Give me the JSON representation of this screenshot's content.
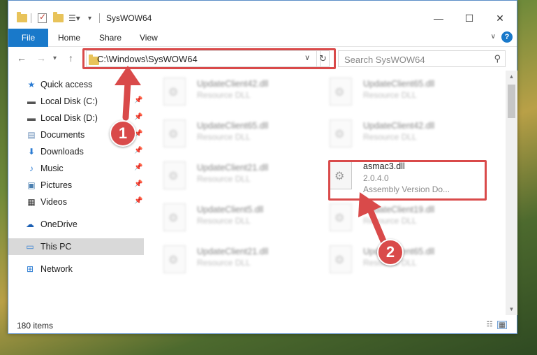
{
  "window": {
    "title": "SysWOW64",
    "controls": {
      "minimize": "—",
      "maximize": "☐",
      "close": "✕"
    }
  },
  "ribbon": {
    "file_tab": "File",
    "tabs": [
      "Home",
      "Share",
      "View"
    ],
    "help": "?"
  },
  "nav": {
    "address": "C:\\Windows\\SysWOW64",
    "search_placeholder": "Search SysWOW64",
    "icons": {
      "back": "back-arrow-icon",
      "forward": "forward-arrow-icon",
      "recent": "chevron-down-icon",
      "up": "up-arrow-icon",
      "refresh": "refresh-icon",
      "search": "search-icon"
    }
  },
  "sidebar": {
    "items": [
      {
        "label": "Quick access",
        "icon": "star-icon",
        "pinned": false
      },
      {
        "label": "Local Disk (C:)",
        "icon": "drive-icon",
        "pinned": true
      },
      {
        "label": "Local Disk (D:)",
        "icon": "drive-icon",
        "pinned": true
      },
      {
        "label": "Documents",
        "icon": "documents-icon",
        "pinned": true
      },
      {
        "label": "Downloads",
        "icon": "downloads-icon",
        "pinned": true
      },
      {
        "label": "Music",
        "icon": "music-icon",
        "pinned": true
      },
      {
        "label": "Pictures",
        "icon": "pictures-icon",
        "pinned": true
      },
      {
        "label": "Videos",
        "icon": "videos-icon",
        "pinned": true
      },
      {
        "label": "OneDrive",
        "icon": "cloud-icon",
        "pinned": false
      },
      {
        "label": "This PC",
        "icon": "computer-icon",
        "pinned": false,
        "selected": true
      },
      {
        "label": "Network",
        "icon": "network-icon",
        "pinned": false
      }
    ]
  },
  "files": [
    {
      "name": "UpdateClient42.dll",
      "type": "Resource DLL"
    },
    {
      "name": "UpdateClient65.dll",
      "type": "Resource DLL"
    },
    {
      "name": "UpdateClient65.dll",
      "type": "Resource DLL"
    },
    {
      "name": "UpdateClient42.dll",
      "type": "Resource DLL"
    },
    {
      "name": "UpdateClient21.dll",
      "type": "Resource DLL"
    },
    {
      "name": "asmac3.dll",
      "version": "2.0.4.0",
      "type": "Assembly Version Do..."
    },
    {
      "name": "UpdateClient5.dll",
      "type": "Resource DLL"
    },
    {
      "name": "UpdateClient19.dll",
      "type": "Resource DLL"
    },
    {
      "name": "UpdateClient21.dll",
      "type": "Resource DLL"
    },
    {
      "name": "UpdateClient65.dll",
      "type": "Resource DLL"
    }
  ],
  "status": {
    "item_count": "180 items"
  },
  "callouts": {
    "step1": "1",
    "step2": "2"
  },
  "colors": {
    "accent": "#1979ca",
    "highlight": "#d94a4a",
    "selected": "#d9d9d9"
  }
}
